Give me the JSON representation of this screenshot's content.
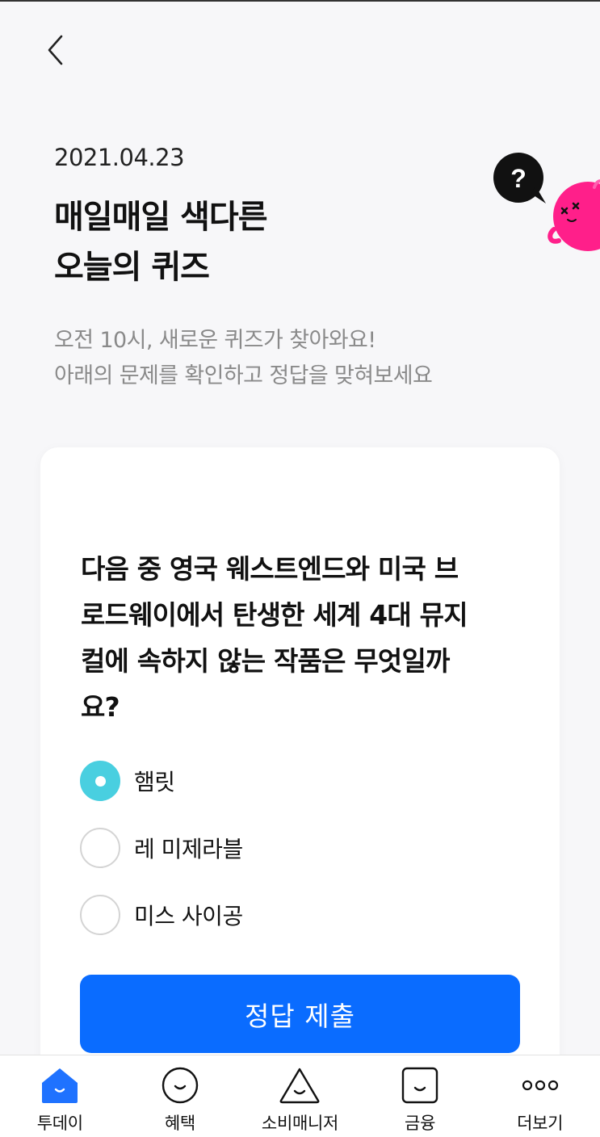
{
  "header": {
    "back_icon": "chevron-left-icon"
  },
  "date": "2021.04.23",
  "title": [
    "매일매일 색다른",
    "오늘의 퀴즈"
  ],
  "subtitle": [
    "오전 10시, 새로운 퀴즈가 찾아와요!",
    "아래의 문제를 확인하고 정답을 맞혀보세요"
  ],
  "mascot": {
    "bubble_text": "?",
    "bubble_color": "#111111",
    "character_color": "#ff1f8a"
  },
  "quiz": {
    "question": "다음 중 영국 웨스트엔드와 미국 브로드웨이에서 탄생한 세계 4대 뮤지컬에 속하지 않는 작품은 무엇일까요?",
    "question_lines": [
      "다음 중 영국 웨스트엔드와 미국 브",
      "로드웨이에서 탄생한 세계 4대 뮤지",
      "컬에 속하지 않는 작품은 무엇일까",
      "요?"
    ],
    "options": [
      {
        "label": "햄릿",
        "selected": true
      },
      {
        "label": "레 미제라블",
        "selected": false
      },
      {
        "label": "미스 사이공",
        "selected": false
      }
    ],
    "submit_label": "정답 제출",
    "accent_color": "#0a6cff",
    "selected_color": "#49cfe0"
  },
  "bottom_nav": [
    {
      "label": "투데이",
      "icon": "home-icon",
      "active": true
    },
    {
      "label": "혜택",
      "icon": "smile-face-icon",
      "active": false
    },
    {
      "label": "소비매니저",
      "icon": "triangle-face-icon",
      "active": false
    },
    {
      "label": "금융",
      "icon": "square-face-icon",
      "active": false
    },
    {
      "label": "더보기",
      "icon": "more-dots-icon",
      "active": false
    }
  ]
}
